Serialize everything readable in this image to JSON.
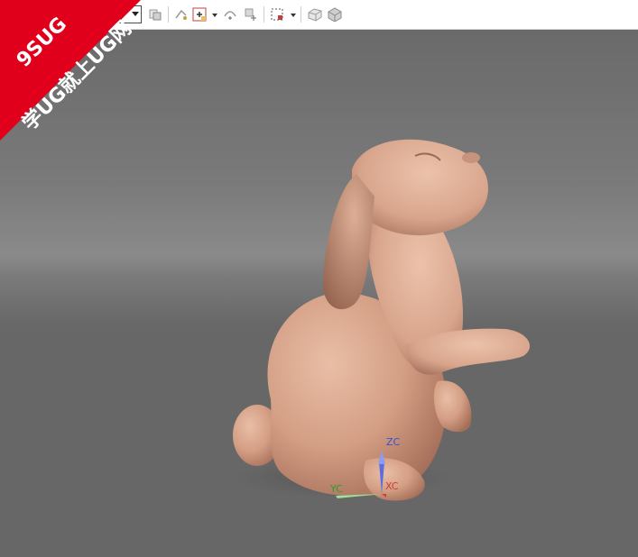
{
  "watermark": {
    "line1": "9SUG",
    "line2": "学UG就上UG网",
    "color": "#e0001b"
  },
  "toolbar": {
    "icons": [
      "selection-filter-dropdown",
      "show-hide-icon",
      "snap-point-icon",
      "snap-filter-icon",
      "point-on-curve-icon",
      "point-on-face-icon",
      "select-rectangle-icon",
      "shaded-wireframe-icon",
      "shaded-solid-icon"
    ]
  },
  "triad": {
    "zc": "ZC",
    "xc": "XC",
    "yc": "YC",
    "colors": {
      "zc": "#3a4fd0",
      "xc": "#d03a3a",
      "yc": "#2f9a2f"
    }
  },
  "model": {
    "color": "#d8a58c"
  }
}
